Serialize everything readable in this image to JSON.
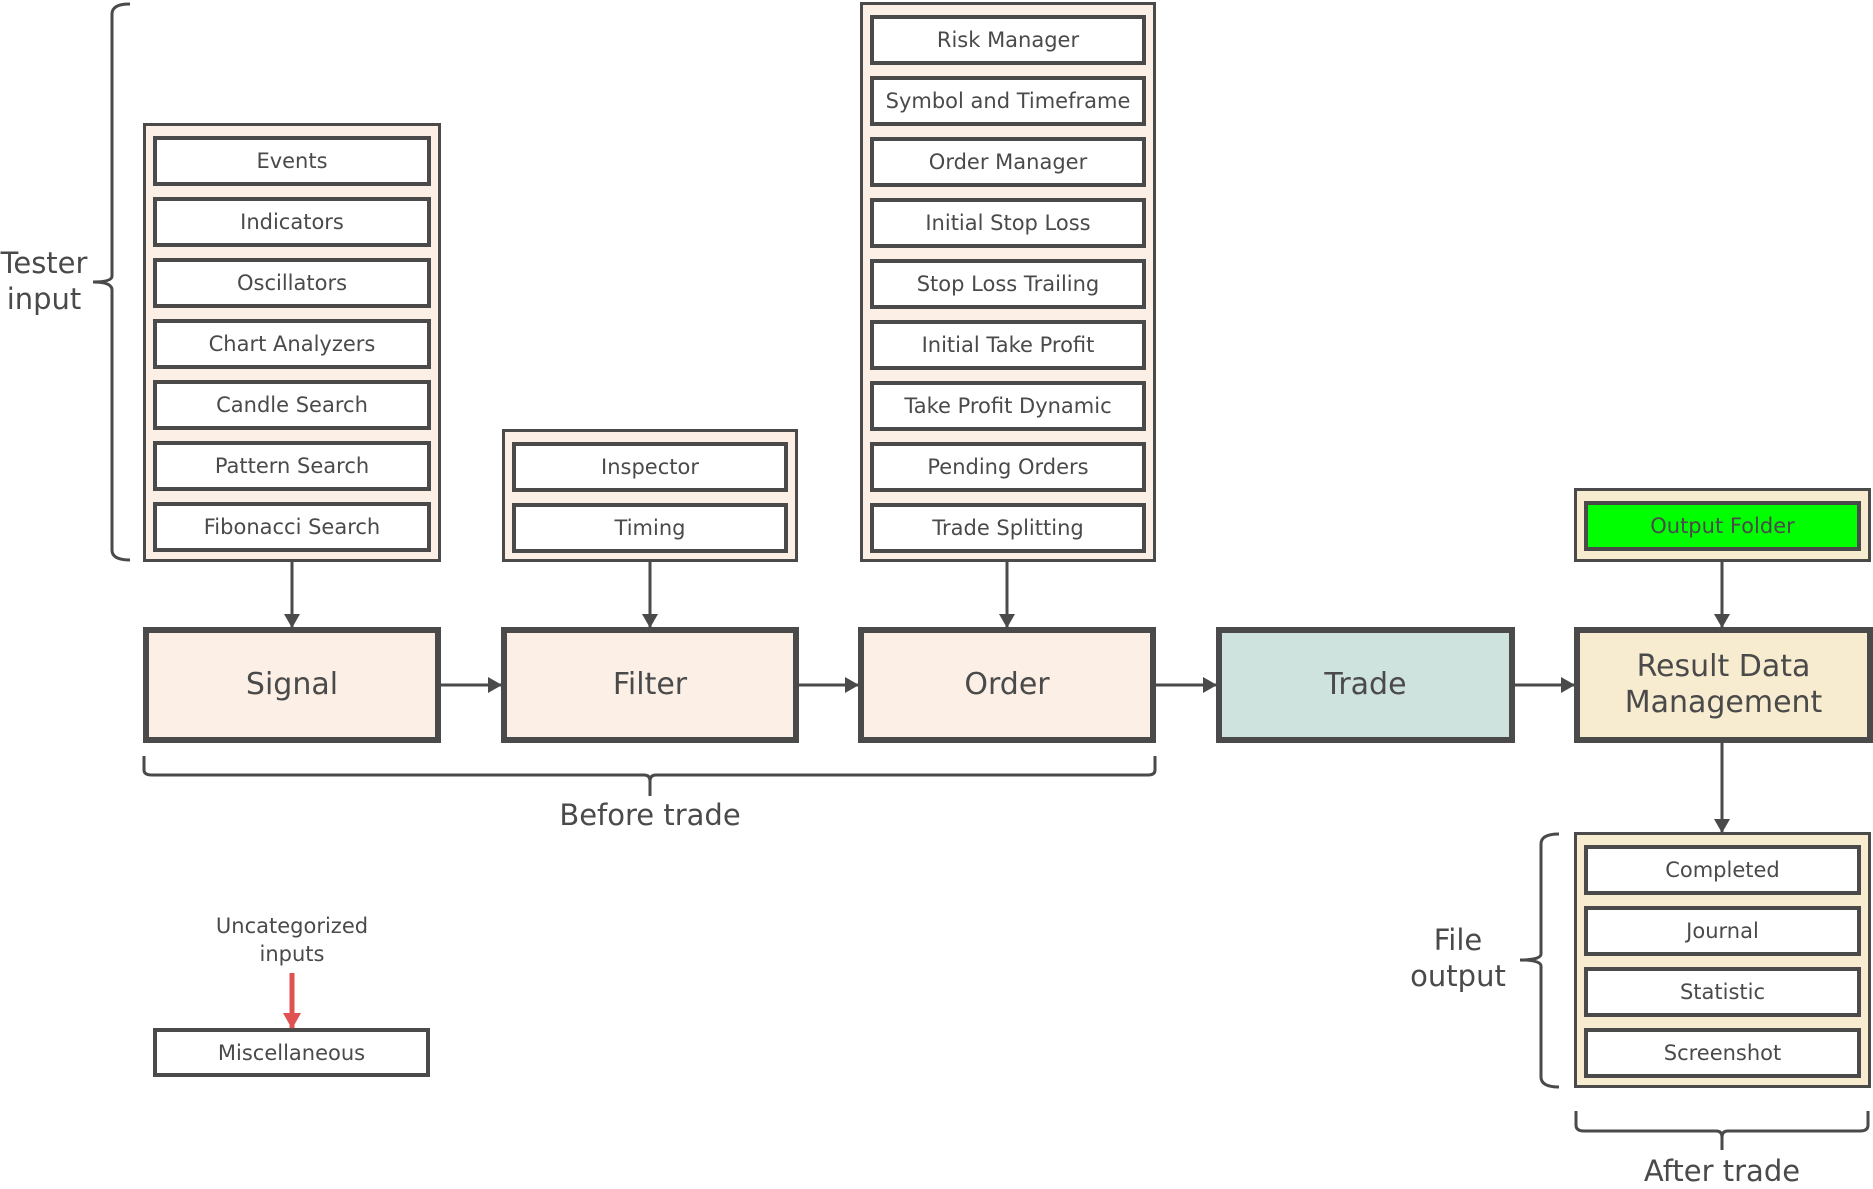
{
  "colors": {
    "stroke": "#4a4a4a",
    "peach_fill": "#fcefe5",
    "teal_fill": "#cfe3de",
    "cream_fill": "#f7ebd0",
    "output_folder_fill": "#00ff00",
    "uncategorized_arrow": "#e05252"
  },
  "labels": {
    "tester_input": "Tester\ninput",
    "before_trade": "Before trade",
    "after_trade": "After trade",
    "file_output": "File\noutput",
    "uncategorized_inputs": "Uncategorized\ninputs"
  },
  "stages": {
    "signal": "Signal",
    "filter": "Filter",
    "order": "Order",
    "trade": "Trade",
    "result": "Result Data\nManagement"
  },
  "signal_inputs": [
    "Events",
    "Indicators",
    "Oscillators",
    "Chart Analyzers",
    "Candle Search",
    "Pattern Search",
    "Fibonacci Search"
  ],
  "filter_inputs": [
    "Inspector",
    "Timing"
  ],
  "order_inputs": [
    "Risk Manager",
    "Symbol and Timeframe",
    "Order Manager",
    "Initial Stop Loss",
    "Stop Loss Trailing",
    "Initial Take Profit",
    "Take Profit Dynamic",
    "Pending Orders",
    "Trade Splitting"
  ],
  "result_inputs": [
    "Output Folder"
  ],
  "file_outputs": [
    "Completed",
    "Journal",
    "Statistic",
    "Screenshot"
  ],
  "misc": "Miscellaneous"
}
